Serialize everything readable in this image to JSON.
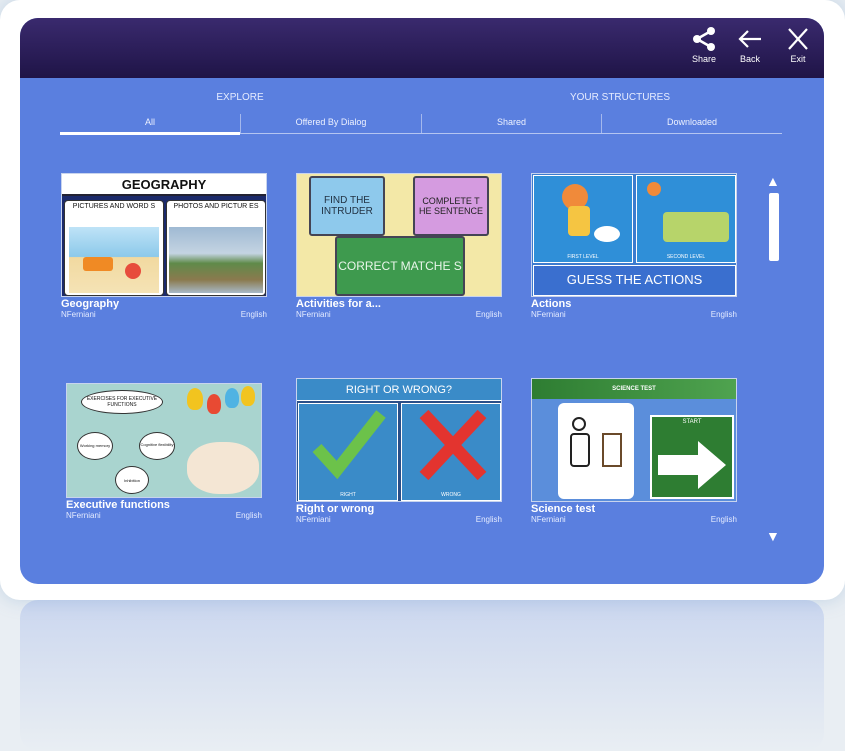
{
  "toolbar": {
    "share_label": "Share",
    "back_label": "Back",
    "exit_label": "Exit"
  },
  "sections": {
    "explore_label": "EXPLORE",
    "your_structures_label": "YOUR STRUCTURES"
  },
  "tabs": [
    {
      "label": "All",
      "active": true
    },
    {
      "label": "Offered By Dialog",
      "active": false
    },
    {
      "label": "Shared",
      "active": false
    },
    {
      "label": "Downloaded",
      "active": false
    }
  ],
  "cards": [
    {
      "title": "Geography",
      "author": "NFerniani",
      "language": "English",
      "thumb": {
        "heading": "GEOGRAPHY",
        "left": "PICTURES AND WORD S",
        "right": "PHOTOS AND PICTUR ES"
      }
    },
    {
      "title": "Activities for a...",
      "author": "NFerniani",
      "language": "English",
      "thumb": {
        "a": "FIND THE INTRUDER",
        "b": "COMPLETE T HE SENTENCE",
        "c": "CORRECT MATCHE S"
      }
    },
    {
      "title": "Actions",
      "author": "NFerniani",
      "language": "English",
      "thumb": {
        "left": "FIRST LEVEL",
        "right": "SECOND LEVEL",
        "banner": "GUESS THE ACTIONS"
      }
    },
    {
      "title": "Executive functions",
      "author": "NFerniani",
      "language": "English",
      "thumb": {
        "main": "EXERCISES FOR EXECUTIVE FUNCTIONS",
        "b1": "Working memory",
        "b2": "Cognitive flexibility",
        "b3": "Inhibition"
      }
    },
    {
      "title": "Right or wrong",
      "author": "NFerniani",
      "language": "English",
      "thumb": {
        "heading": "RIGHT OR WRONG?",
        "left": "RIGHT",
        "right": "WRONG"
      }
    },
    {
      "title": "Science test",
      "author": "NFerniani",
      "language": "English",
      "thumb": {
        "heading": "SCIENCE TEST",
        "start": "START"
      }
    }
  ],
  "colors": {
    "app_bg": "#5a7fdf",
    "topbar": "#2a1d5a",
    "accent": "#ffffff"
  }
}
